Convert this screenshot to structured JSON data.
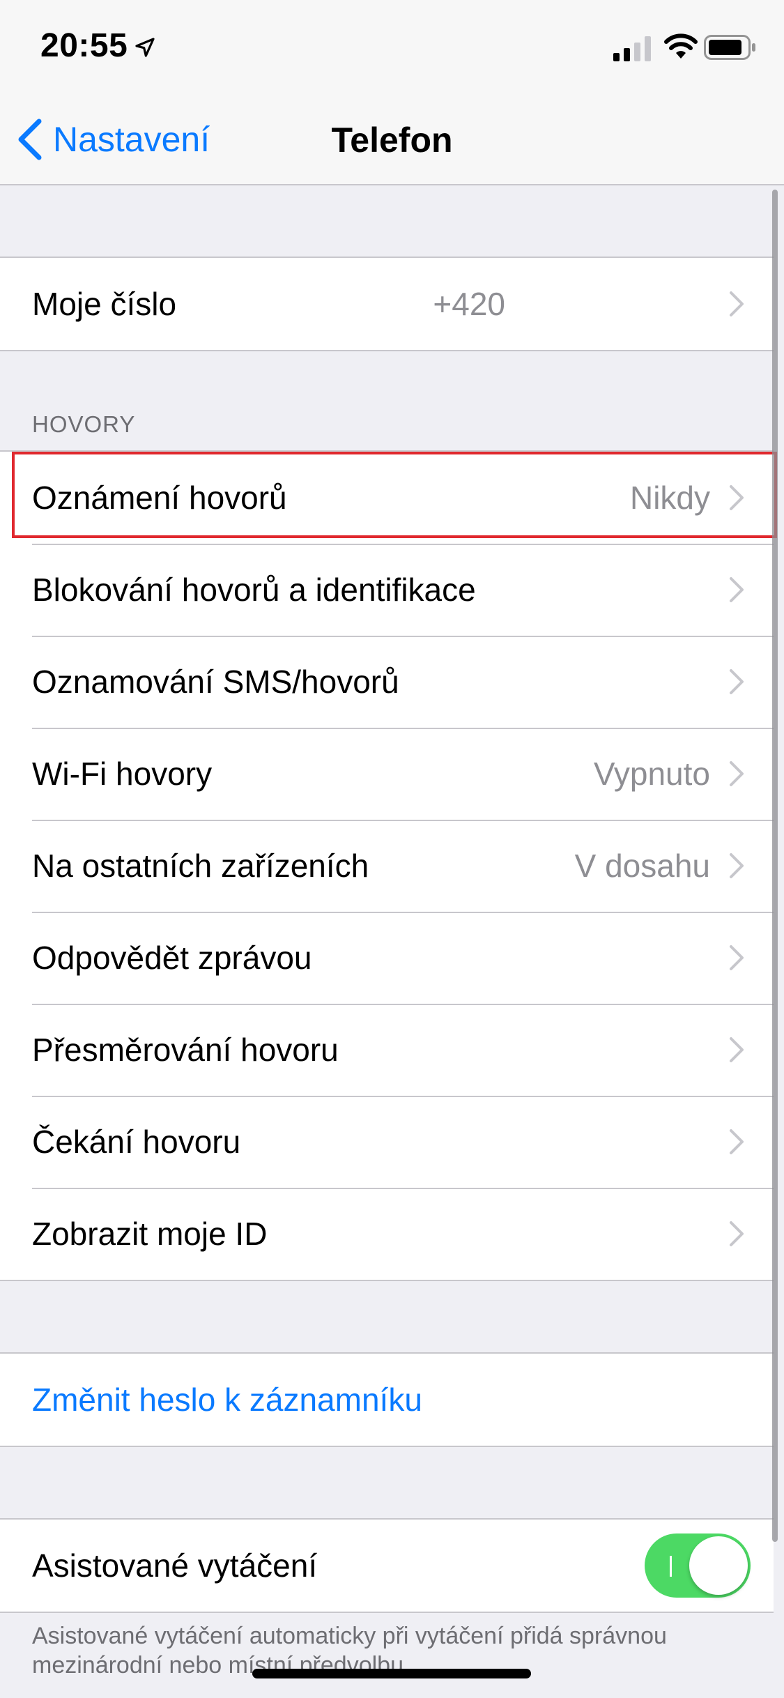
{
  "status_bar": {
    "time": "20:55",
    "icons": [
      "location-arrow-icon",
      "cellular-signal-icon",
      "wifi-icon",
      "battery-icon"
    ]
  },
  "nav": {
    "back_label": "Nastavení",
    "title": "Telefon"
  },
  "my_number": {
    "label": "Moje číslo",
    "value": "+420"
  },
  "calls_section": {
    "header": "HOVORY",
    "items": [
      {
        "label": "Oznámení hovorů",
        "value": "Nikdy"
      },
      {
        "label": "Blokování hovorů a identifikace",
        "value": ""
      },
      {
        "label": "Oznamování SMS/hovorů",
        "value": ""
      },
      {
        "label": "Wi-Fi hovory",
        "value": "Vypnuto"
      },
      {
        "label": "Na ostatních zařízeních",
        "value": "V dosahu"
      },
      {
        "label": "Odpovědět zprávou",
        "value": ""
      },
      {
        "label": "Přesměrování hovoru",
        "value": ""
      },
      {
        "label": "Čekání hovoru",
        "value": ""
      },
      {
        "label": "Zobrazit moje ID",
        "value": ""
      }
    ]
  },
  "voicemail": {
    "change_password_label": "Změnit heslo k záznamníku"
  },
  "assisted_dialing": {
    "label": "Asistované vytáčení",
    "enabled": true,
    "footer": "Asistované vytáčení automaticky při vytáčení přidá správnou mezinárodní nebo místní předvolbu."
  },
  "colors": {
    "accent": "#0a7aff",
    "toggle_on": "#4cd964",
    "highlight": "#e0282e",
    "background": "#efeff4",
    "secondary_text": "#8e8e93"
  }
}
